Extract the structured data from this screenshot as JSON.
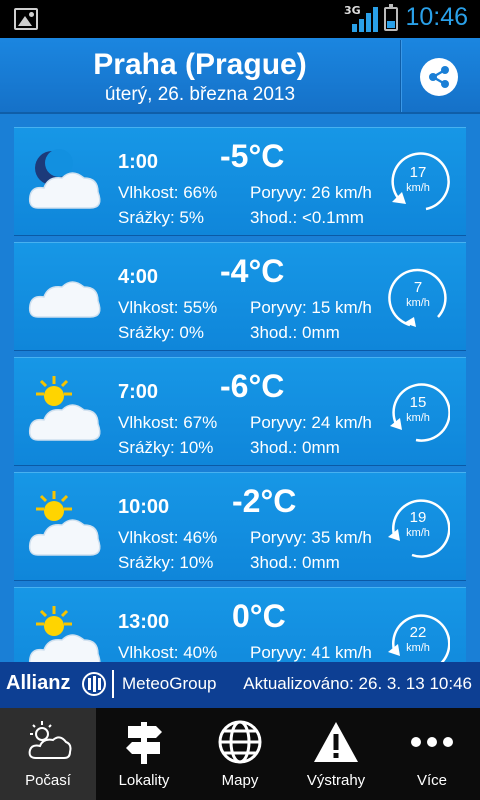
{
  "status_bar": {
    "network": "3G",
    "time": "10:46"
  },
  "header": {
    "city": "Praha (Prague)",
    "date": "úterý, 26. března 2013"
  },
  "forecast": [
    {
      "time": "1:00",
      "icon": "moon-cloud-icon",
      "temp": "-5°C",
      "humidity": "Vlhkost: 66%",
      "gusts": "Poryvy: 26 km/h",
      "precip": "Srážky: 5%",
      "precip_3h": "3hod.: <0.1mm",
      "wind_speed": "17",
      "wind_unit": "km/h"
    },
    {
      "time": "4:00",
      "icon": "cloud-icon",
      "temp": "-4°C",
      "humidity": "Vlhkost: 55%",
      "gusts": "Poryvy: 15 km/h",
      "precip": "Srážky: 0%",
      "precip_3h": "3hod.: 0mm",
      "wind_speed": "7",
      "wind_unit": "km/h"
    },
    {
      "time": "7:00",
      "icon": "sun-cloud-icon",
      "temp": "-6°C",
      "humidity": "Vlhkost: 67%",
      "gusts": "Poryvy: 24 km/h",
      "precip": "Srážky: 10%",
      "precip_3h": "3hod.: 0mm",
      "wind_speed": "15",
      "wind_unit": "km/h"
    },
    {
      "time": "10:00",
      "icon": "sun-cloud-icon",
      "temp": "-2°C",
      "humidity": "Vlhkost: 46%",
      "gusts": "Poryvy: 35 km/h",
      "precip": "Srážky: 10%",
      "precip_3h": "3hod.: 0mm",
      "wind_speed": "19",
      "wind_unit": "km/h"
    },
    {
      "time": "13:00",
      "icon": "sun-cloud-icon",
      "temp": "0°C",
      "humidity": "Vlhkost: 40%",
      "gusts": "Poryvy: 41 km/h",
      "precip": "",
      "precip_3h": "",
      "wind_speed": "22",
      "wind_unit": "km/h"
    }
  ],
  "brand": {
    "allianz": "Allianz",
    "meteo": "MeteoGroup",
    "updated": "Aktualizováno: 26. 3. 13 10:46"
  },
  "nav": [
    {
      "label": "Počasí",
      "icon": "weather-icon",
      "active": true
    },
    {
      "label": "Lokality",
      "icon": "signpost-icon",
      "active": false
    },
    {
      "label": "Mapy",
      "icon": "globe-icon",
      "active": false
    },
    {
      "label": "Výstrahy",
      "icon": "warning-icon",
      "active": false
    },
    {
      "label": "Více",
      "icon": "more-icon",
      "active": false
    }
  ],
  "colors": {
    "background": "#1a7fd6",
    "card": "#1290e0",
    "brand_bar": "#0d3f93",
    "nav_bar": "#0c0c0c",
    "status_accent": "#2aa0e8"
  }
}
